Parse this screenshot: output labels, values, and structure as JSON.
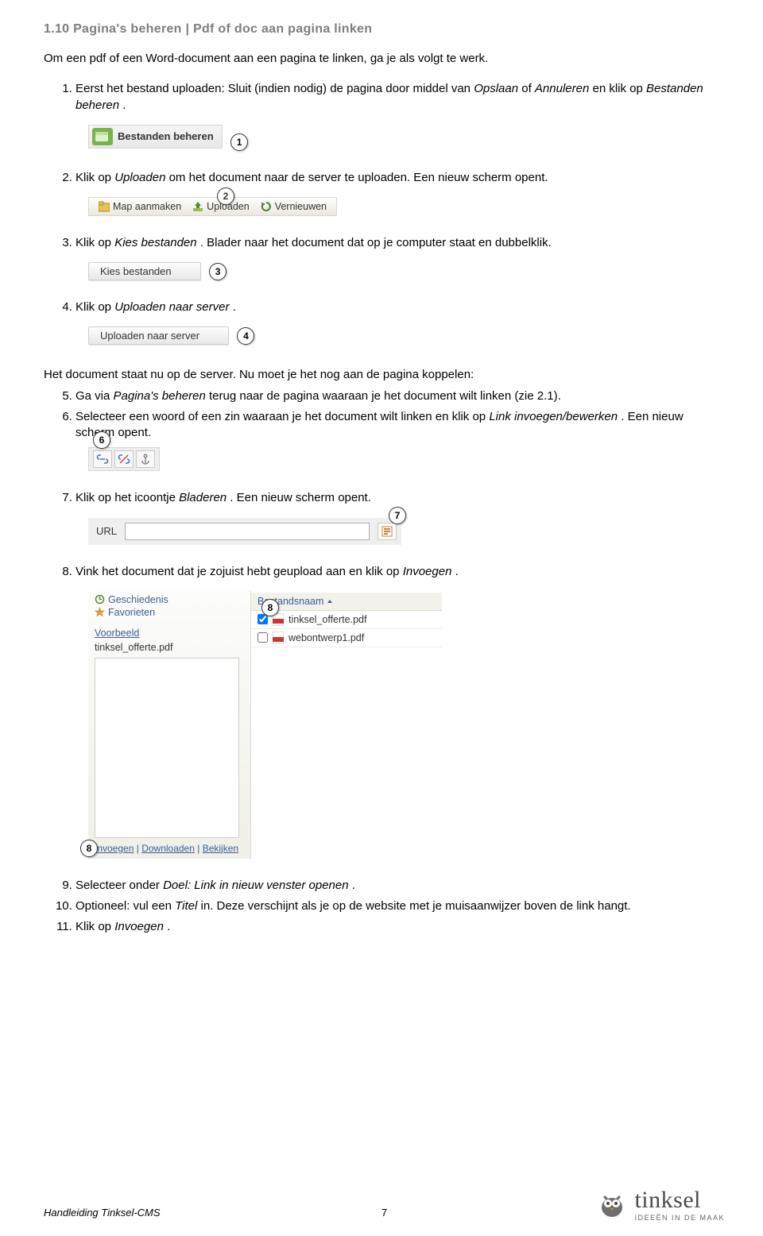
{
  "title": "1.10 Pagina's beheren | Pdf of doc aan pagina linken",
  "intro": "Om een pdf of een Word-document aan een pagina te linken, ga je als volgt te werk.",
  "steps": {
    "s1a": "Eerst het bestand uploaden: Sluit (indien nodig) de pagina door middel van ",
    "s1_opslaan": "Opslaan",
    "s1_of": " of ",
    "s1_annuleren": "Annuleren",
    "s1b": " en klik op ",
    "s1_bestanden": "Bestanden beheren",
    "s1c": ".",
    "s2a": "Klik op ",
    "s2_uploaden": "Uploaden",
    "s2b": " om het document naar de server te uploaden. Een nieuw scherm opent.",
    "s3a": "Klik op ",
    "s3_kies": "Kies bestanden",
    "s3b": ". Blader naar het document dat op je computer staat en dubbelklik.",
    "s4a": "Klik op ",
    "s4_upload": "Uploaden naar server",
    "s4b": ".",
    "midline": "Het document staat nu op de server. Nu moet je het nog aan de pagina koppelen:",
    "s5a": "Ga via ",
    "s5_ph": "Pagina's beheren",
    "s5b": " terug naar de pagina waaraan je het document wilt linken (zie 2.1).",
    "s6a": "Selecteer een woord of een zin waaraan je het document wilt linken en klik op ",
    "s6_link": "Link invoegen/bewerken",
    "s6b": ". Een nieuw scherm opent.",
    "s7a": "Klik op het icoontje ",
    "s7_blad": "Bladeren",
    "s7b": ". Een nieuw scherm opent.",
    "s8a": "Vink het document dat je zojuist hebt geupload aan en klik op ",
    "s8_inv": "Invoegen",
    "s8b": ".",
    "s9a": "Selecteer onder ",
    "s9_doel": "Doel: Link in nieuw venster openen",
    "s9b": ".",
    "s10a": "Optioneel: vul een ",
    "s10_titel": "Titel",
    "s10b": " in. Deze verschijnt als je op de website met je muisaanwijzer boven de link hangt.",
    "s11a": "Klik op ",
    "s11_inv": "Invoegen",
    "s11b": "."
  },
  "fig1": {
    "label": "Bestanden beheren",
    "bubble": "1"
  },
  "fig2": {
    "items": [
      "Map aanmaken",
      "Uploaden",
      "Vernieuwen"
    ],
    "bubble": "2"
  },
  "fig3": {
    "label": "Kies bestanden",
    "bubble": "3"
  },
  "fig4": {
    "label": "Uploaden naar server",
    "bubble": "4"
  },
  "fig6": {
    "bubble": "6"
  },
  "fig7": {
    "label": "URL",
    "bubble": "7"
  },
  "fig8": {
    "bubble_top": "8",
    "bubble_bottom": "8",
    "left": {
      "history": "Geschiedenis",
      "favorites": "Favorieten",
      "preview_label": "Voorbeeld",
      "selected_file": "tinksel_offerte.pdf",
      "actions": [
        "Invoegen",
        "Downloaden",
        "Bekijken"
      ]
    },
    "right": {
      "col_header": "Bestandsnaam",
      "files": [
        {
          "name": "tinksel_offerte.pdf",
          "checked": true
        },
        {
          "name": "webontwerp1.pdf",
          "checked": false
        }
      ]
    }
  },
  "footer": {
    "doc_name": "Handleiding Tinksel-CMS",
    "page_no": "7",
    "logo_text": "tinksel",
    "logo_tag": "IDEEËN IN DE MAAK"
  }
}
